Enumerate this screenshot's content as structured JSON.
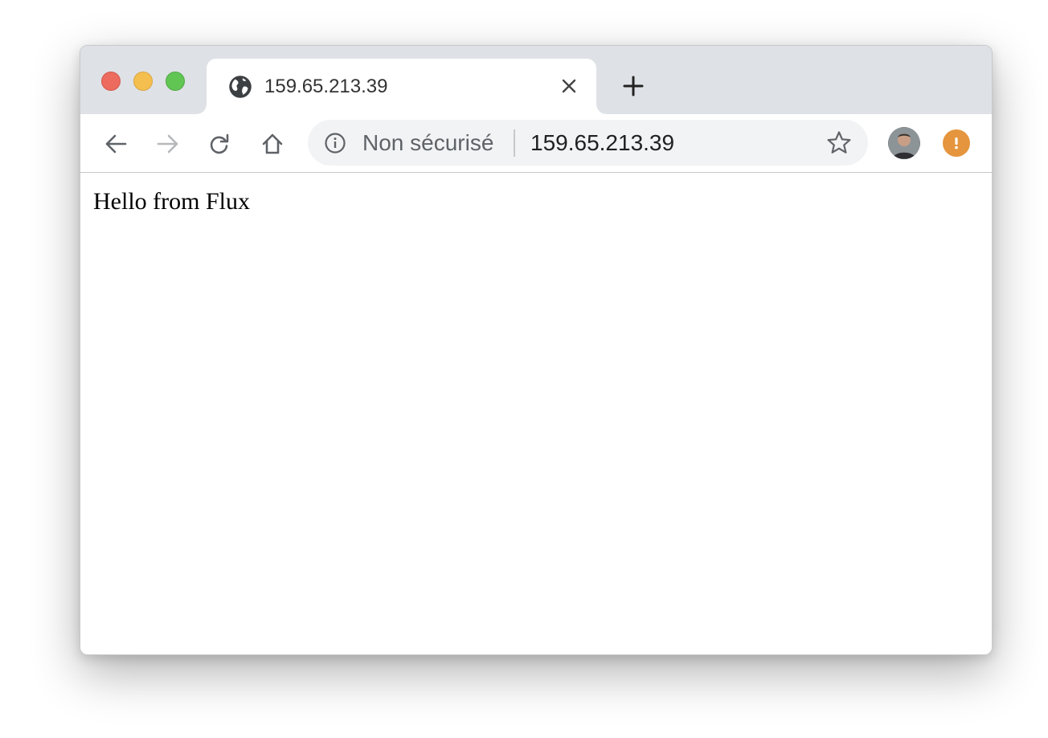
{
  "window": {
    "controls": [
      "close",
      "minimize",
      "maximize"
    ],
    "colors": {
      "close": "#ec6a5e",
      "minimize": "#f4bf4f",
      "maximize": "#61c554"
    }
  },
  "tab": {
    "favicon": "globe-icon",
    "title": "159.65.213.39",
    "close_icon": "close-icon"
  },
  "new_tab_icon": "plus-icon",
  "toolbar": {
    "back_icon": "arrow-left-icon",
    "forward_icon": "arrow-right-icon",
    "reload_icon": "reload-icon",
    "home_icon": "home-icon"
  },
  "omnibox": {
    "security_icon": "info-icon",
    "security_label": "Non sécurisé",
    "url": "159.65.213.39",
    "bookmark_icon": "star-icon"
  },
  "profile": {
    "avatar": "avatar"
  },
  "alert": {
    "icon": "exclamation-icon",
    "color": "#e5953d"
  },
  "page": {
    "text": "Hello from Flux"
  }
}
